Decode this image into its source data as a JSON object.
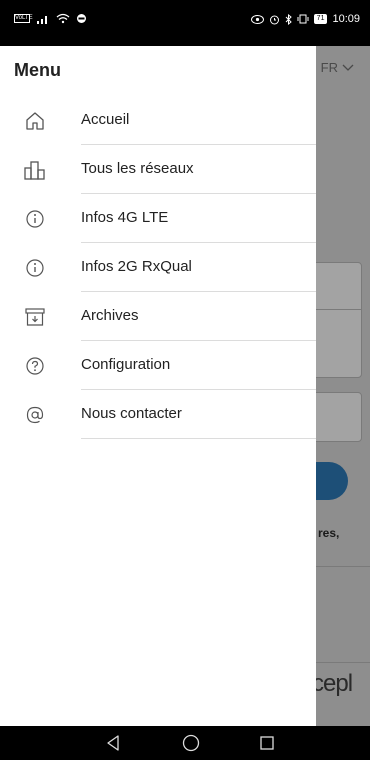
{
  "status_bar": {
    "carrier_badge": "VoLTE",
    "time": "10:09",
    "battery": "71"
  },
  "background": {
    "language": "FR",
    "partial_text": "res,",
    "logo_fragment": "cepl"
  },
  "drawer": {
    "title": "Menu",
    "items": [
      {
        "label": "Accueil",
        "icon": "home-icon"
      },
      {
        "label": "Tous les réseaux",
        "icon": "bar-chart-icon"
      },
      {
        "label": "Infos 4G LTE",
        "icon": "info-icon"
      },
      {
        "label": "Infos 2G RxQual",
        "icon": "info-icon"
      },
      {
        "label": "Archives",
        "icon": "archive-icon"
      },
      {
        "label": "Configuration",
        "icon": "help-icon"
      },
      {
        "label": "Nous contacter",
        "icon": "at-icon"
      }
    ]
  },
  "nav": {
    "back": "back-icon",
    "home": "home-circle-icon",
    "recents": "recents-icon"
  },
  "colors": {
    "drawer_bg": "#ffffff",
    "scrim": "#8e8e8e",
    "accent_button": "#1d4f77",
    "divider": "#dcdcdc"
  }
}
